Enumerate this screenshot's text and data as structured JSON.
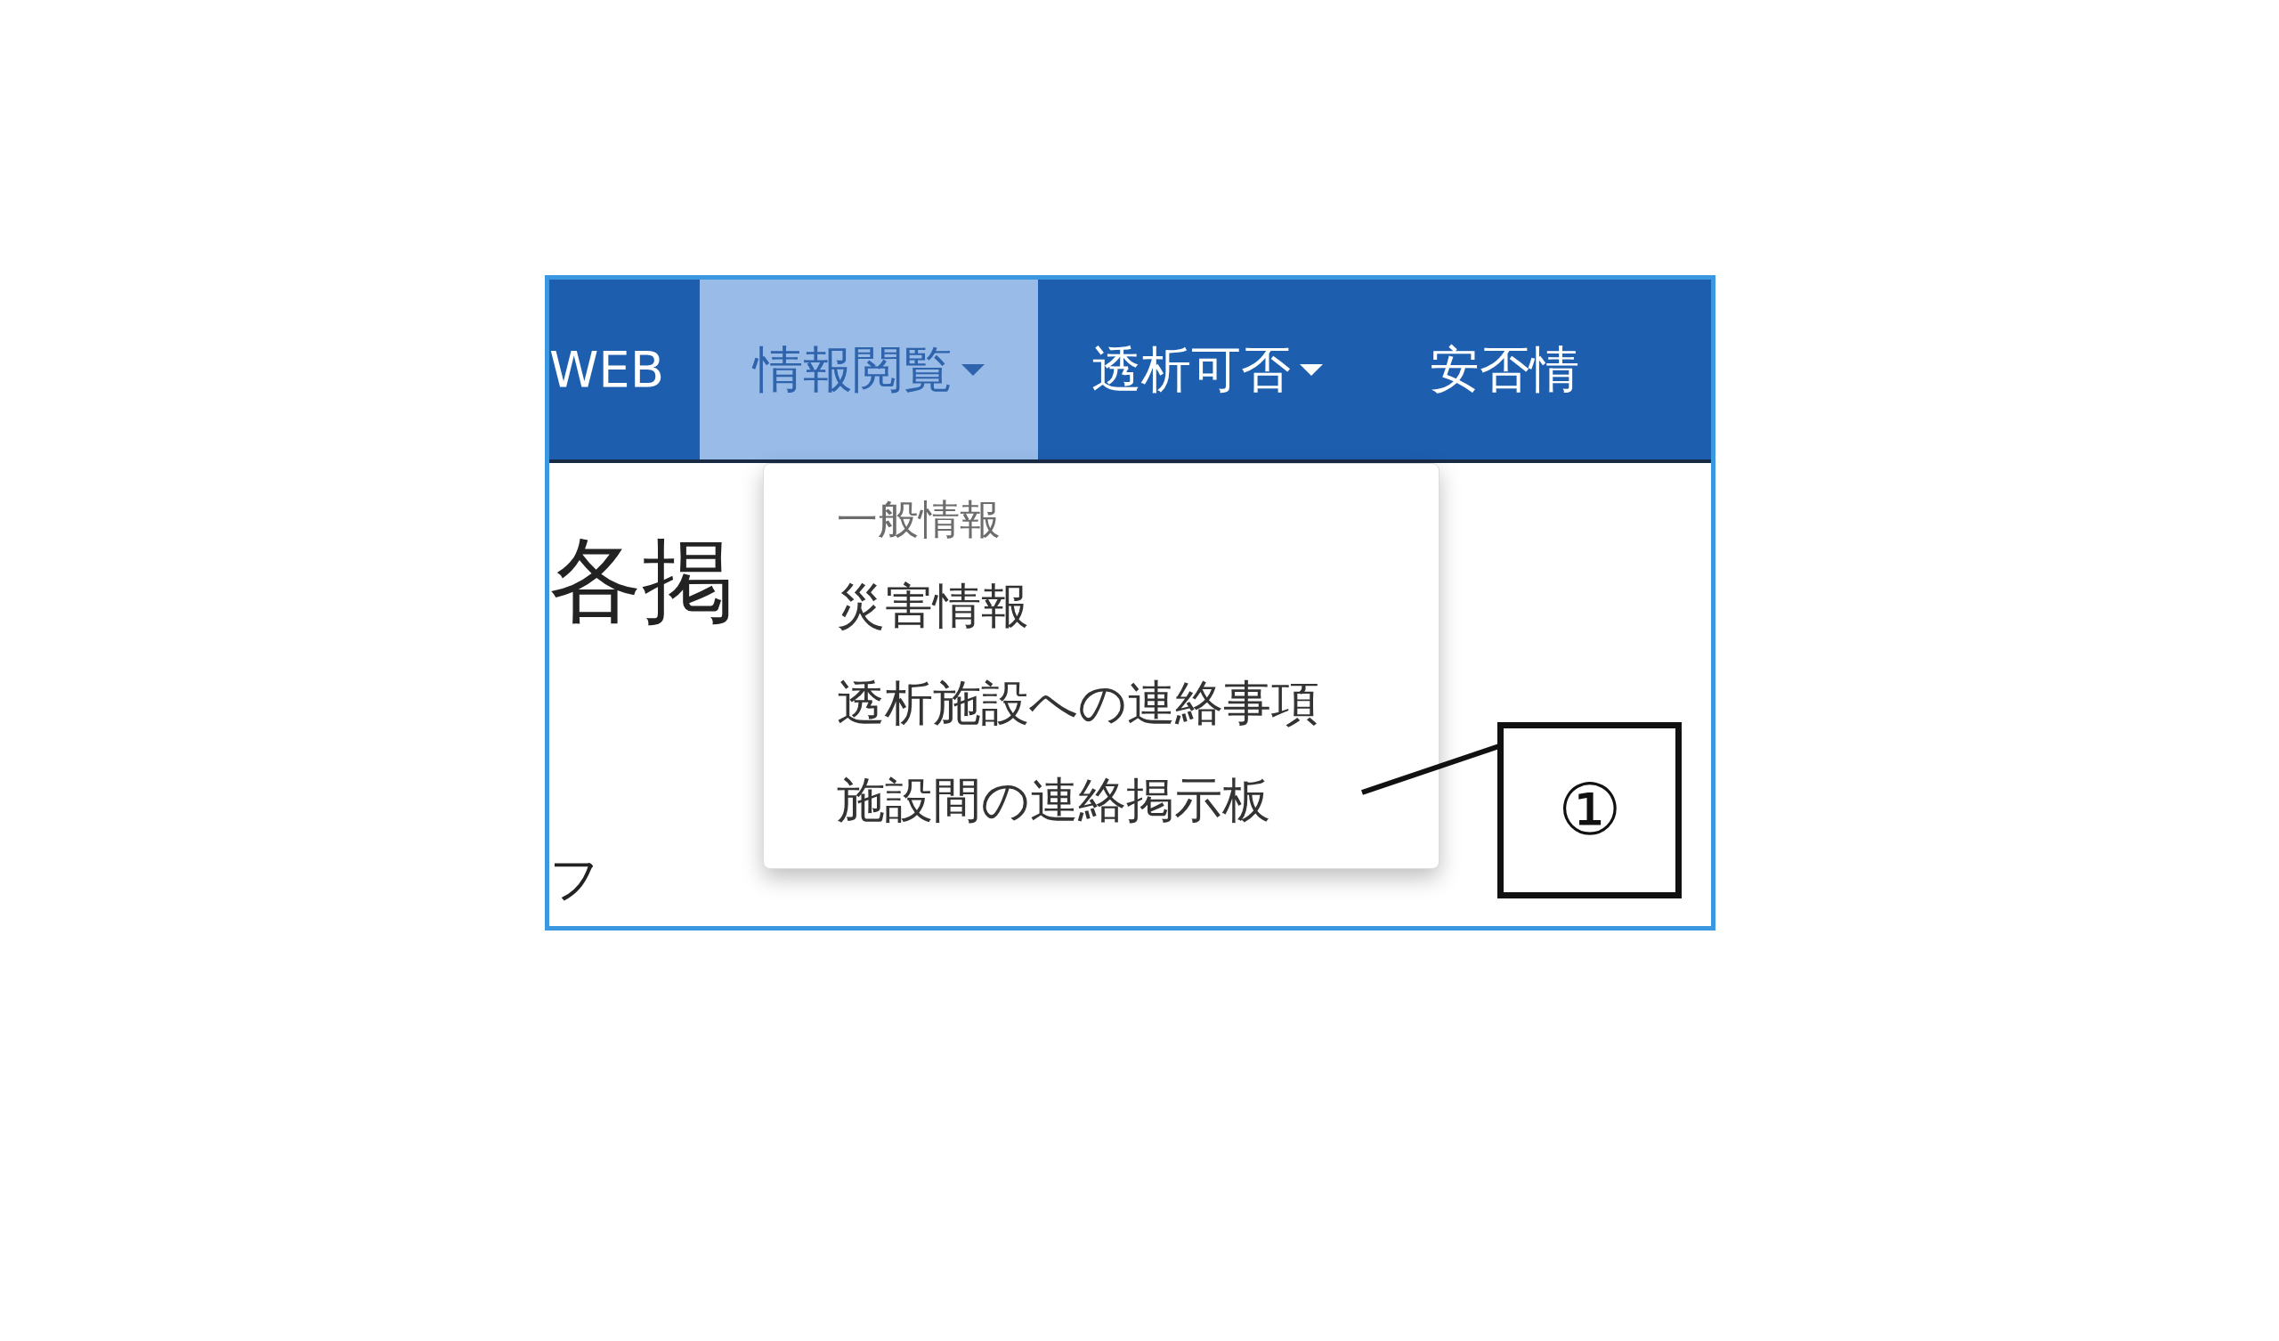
{
  "navbar": {
    "items": [
      {
        "label": "WEB",
        "selected": false,
        "dropdown": false
      },
      {
        "label": "情報閲覧",
        "selected": true,
        "dropdown": true
      },
      {
        "label": "透析可否",
        "selected": false,
        "dropdown": true
      },
      {
        "label": "安否情",
        "selected": false,
        "dropdown": false
      }
    ]
  },
  "dropdown_menu": {
    "items": [
      {
        "kind": "header",
        "label": "一般情報"
      },
      {
        "kind": "item",
        "label": "災害情報"
      },
      {
        "kind": "item",
        "label": "透析施設への連絡事項"
      },
      {
        "kind": "item",
        "label": "施設間の連絡掲示板"
      }
    ]
  },
  "page": {
    "heading": "各掲",
    "text": "フ"
  },
  "callout": {
    "label": "①"
  }
}
